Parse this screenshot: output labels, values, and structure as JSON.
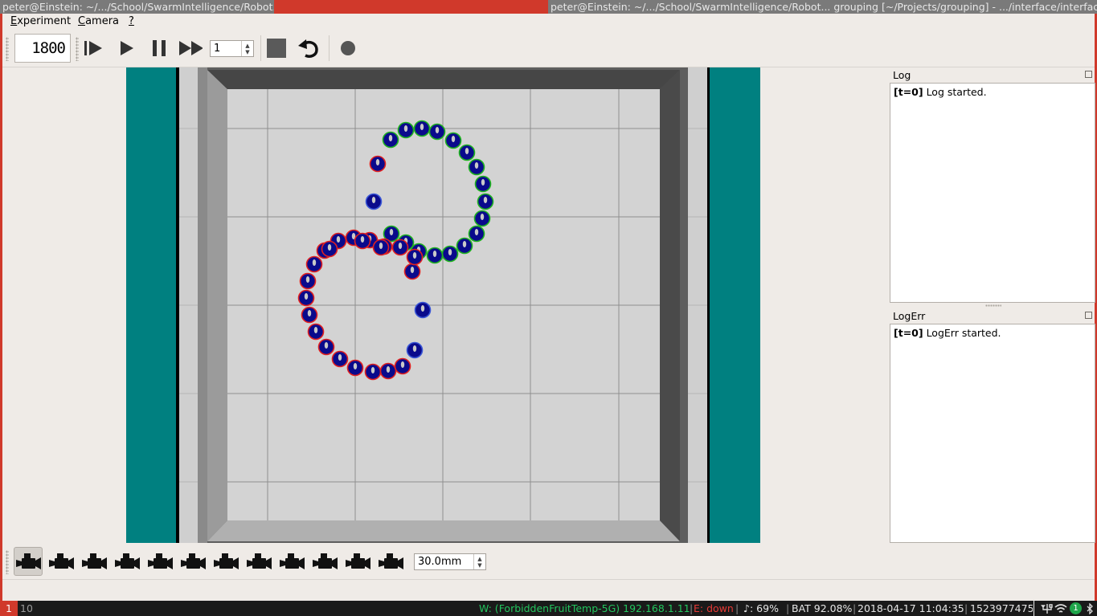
{
  "taskbar": {
    "windows": [
      {
        "title": "peter@Einstein: ~/.../School/SwarmIntelligence/Robot..."
      },
      {
        "title": "peter@Einstein: ~/.../School/SwarmIntelligence/Robot... grouping [~/Projects/grouping] - .../interface/interface..."
      }
    ]
  },
  "menu": {
    "items": [
      {
        "label": "Experiment",
        "mnemonic": "E"
      },
      {
        "label": "Camera",
        "mnemonic": "C"
      },
      {
        "label": "?"
      }
    ]
  },
  "toolbar": {
    "step_counter": "1800",
    "step_spin_value": "1",
    "icons": [
      "step-icon",
      "play-icon",
      "pause-icon",
      "fast-forward-icon",
      "stop-icon",
      "reset-icon",
      "record-icon"
    ]
  },
  "panels": {
    "log": {
      "title": "Log",
      "time_tag": "[t=0]",
      "message": "Log started."
    },
    "logerr": {
      "title": "LogErr",
      "time_tag": "[t=0]",
      "message": "LogErr started."
    }
  },
  "camera_bar": {
    "camera_count": 12,
    "selected_index": 0,
    "focal_length": "30.0mm"
  },
  "statusbar": {
    "workspaces": [
      "1",
      "10"
    ],
    "active_workspace": "1",
    "wifi": "W: (ForbiddenFruitTemp-5G) 192.168.1.11",
    "ethernet": "E: down",
    "volume": "♪: 69%",
    "battery": "BAT 92.08%",
    "datetime": "2018-04-17 11:04:35",
    "epoch": "1523977475",
    "notification_count": "1",
    "colors": {
      "wifi": "#22c55e",
      "ethernet": "#e53935",
      "accent": "#d0392b"
    }
  },
  "arena": {
    "colors": {
      "wall": "#008080",
      "floor": "#d4d4d4",
      "robot": "#0a0a8c"
    },
    "robot_led_green": 17,
    "robot_led_red": 24,
    "robot_led_blue": 3
  }
}
